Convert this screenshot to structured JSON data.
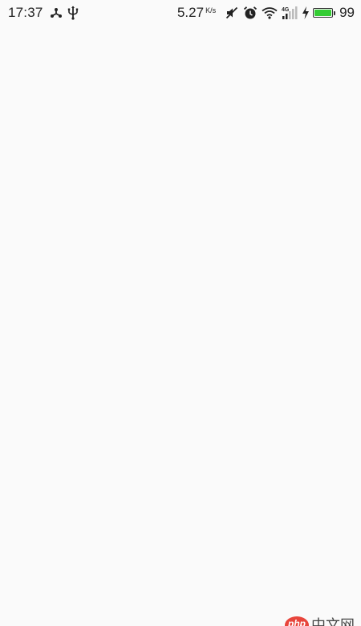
{
  "status_bar": {
    "time": "17:37",
    "left_icons": [
      "network-share-icon",
      "usb-icon"
    ],
    "speed_value": "5.27",
    "speed_unit": "K/s",
    "right_icons": [
      "mute-icon",
      "alarm-icon",
      "wifi-icon",
      "signal-4g-icon",
      "charging-icon",
      "battery-icon"
    ],
    "network_type": "4G",
    "battery_level": 0.99,
    "battery_percent": "99",
    "battery_color": "#33cc33"
  },
  "watermark": {
    "badge_text": "php",
    "site_text": "中文网",
    "badge_color": "#e8453c"
  }
}
